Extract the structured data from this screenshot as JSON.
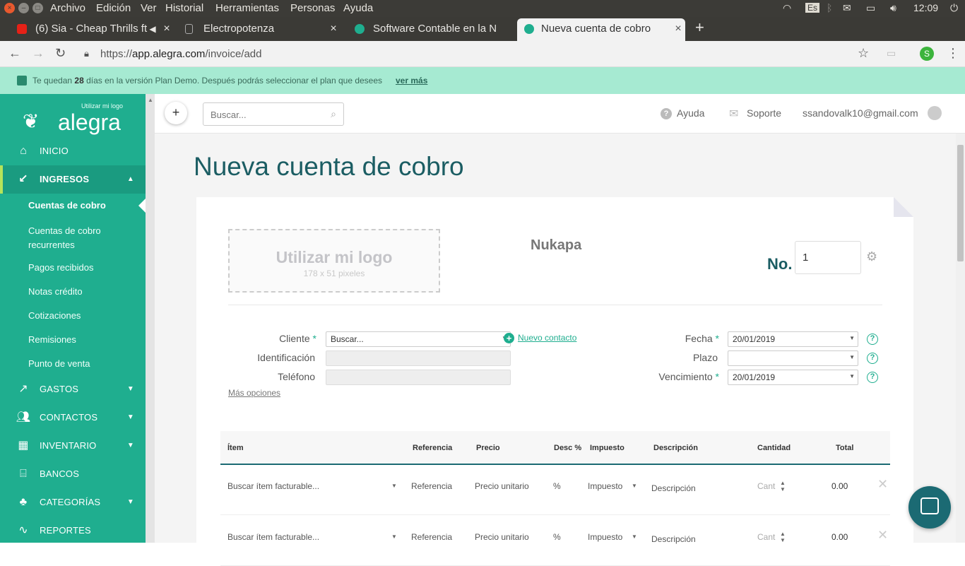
{
  "os": {
    "menu": [
      "Archivo",
      "Edición",
      "Ver",
      "Historial",
      "Herramientas",
      "Personas",
      "Ayuda"
    ],
    "keyboard": "Es",
    "time": "12:09"
  },
  "tabs": [
    {
      "title": "(6) Sia - Cheap Thrills ft",
      "active": false
    },
    {
      "title": "Electropotenza",
      "active": false
    },
    {
      "title": "Software Contable en la N",
      "active": false
    },
    {
      "title": "Nueva cuenta de cobro",
      "active": true
    }
  ],
  "address": {
    "scheme": "https://",
    "host": "app.alegra.com",
    "path": "/invoice/add",
    "profile_initial": "S"
  },
  "banner": {
    "pre": "Te quedan",
    "days": "28",
    "post": "días en la versión Plan Demo. Después podrás seleccionar el plan que desees",
    "link": "ver más"
  },
  "sidebar": {
    "logo_sub": "Utilizar mi logo",
    "logo_text": "alegra",
    "items": [
      {
        "label": "INICIO",
        "icon": "home-icon"
      },
      {
        "label": "INGRESOS",
        "icon": "income-icon"
      },
      {
        "label": "GASTOS",
        "icon": "expenses-icon"
      },
      {
        "label": "CONTACTOS",
        "icon": "contacts-icon"
      },
      {
        "label": "INVENTARIO",
        "icon": "inventory-icon"
      },
      {
        "label": "BANCOS",
        "icon": "bank-icon"
      },
      {
        "label": "CATEGORÍAS",
        "icon": "categories-icon"
      },
      {
        "label": "REPORTES",
        "icon": "reports-icon"
      }
    ],
    "subitems": [
      "Cuentas de cobro",
      "Cuentas de cobro recurrentes",
      "Pagos recibidos",
      "Notas crédito",
      "Cotizaciones",
      "Remisiones",
      "Punto de venta"
    ]
  },
  "topbar": {
    "search_placeholder": "Buscar...",
    "help": "Ayuda",
    "support": "Soporte",
    "email": "ssandovalk10@gmail.com"
  },
  "page": {
    "title": "Nueva cuenta de cobro"
  },
  "invoice": {
    "logo_title": "Utilizar mi logo",
    "logo_size": "178 x 51 pixeles",
    "company": "Nukapa",
    "no_label": "No.",
    "number": "1",
    "client_label": "Cliente",
    "client_placeholder": "Buscar...",
    "new_contact": "Nuevo contacto",
    "id_label": "Identificación",
    "phone_label": "Teléfono",
    "more_options": "Más opciones",
    "date_label": "Fecha",
    "date": "20/01/2019",
    "term_label": "Plazo",
    "term": "",
    "due_label": "Vencimiento",
    "due": "20/01/2019"
  },
  "table": {
    "headers": [
      "Ítem",
      "Referencia",
      "Precio",
      "Desc %",
      "Impuesto",
      "Descripción",
      "Cantidad",
      "Total"
    ],
    "rows": [
      {
        "item": "Buscar ítem facturable...",
        "ref": "Referencia",
        "price": "Precio unitario",
        "disc": "%",
        "tax": "Impuesto",
        "desc": "Descripción",
        "qty": "Cant",
        "total": "0.00"
      },
      {
        "item": "Buscar ítem facturable...",
        "ref": "Referencia",
        "price": "Precio unitario",
        "disc": "%",
        "tax": "Impuesto",
        "desc": "Descripción",
        "qty": "Cant",
        "total": "0.00"
      }
    ]
  },
  "colors": {
    "brand": "#1fae8f",
    "dark_teal": "#1b5d63",
    "banner": "#a6ead2"
  }
}
